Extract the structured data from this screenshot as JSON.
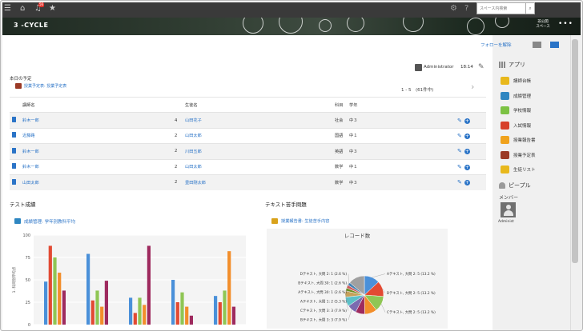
{
  "topbar": {
    "menu_icon": "hamburger-menu-icon",
    "home_icon": "home-icon",
    "bell_icon": "bell-icon",
    "notification_badge": "56",
    "star_icon": "star-icon",
    "gear_icon": "gear-icon",
    "help_icon": "help-icon",
    "search_placeholder": "スペース内検索",
    "search_icon": "search-icon"
  },
  "space": {
    "title": "3 -CYCLE",
    "private_badge": "非公開\nスペース",
    "more": "•••",
    "follow_label": "フォローを解除"
  },
  "post": {
    "author": "Administrator",
    "time": "18:14"
  },
  "schedule": {
    "heading": "本日の予定",
    "app_name": "授業予定表: 授業予定表",
    "pager": "1 - 5　(61件中)",
    "next": "›",
    "columns": [
      "講師名",
      "",
      "生徒名",
      "科目",
      "学年"
    ],
    "rows": [
      {
        "teacher": "鈴木一郎",
        "num": "4",
        "student": "山田花子",
        "subject": "社会",
        "grade": "中３"
      },
      {
        "teacher": "近藤路",
        "num": "2",
        "student": "山田太郎",
        "subject": "国語",
        "grade": "中１"
      },
      {
        "teacher": "鈴木一郎",
        "num": "2",
        "student": "川田五郎",
        "subject": "英語",
        "grade": "中３"
      },
      {
        "teacher": "鈴木一郎",
        "num": "2",
        "student": "山田太郎",
        "subject": "数学",
        "grade": "中１"
      },
      {
        "teacher": "山田太郎",
        "num": "2",
        "student": "豊田剛太郎",
        "subject": "数学",
        "grade": "中３"
      }
    ]
  },
  "widget_scores": {
    "title": "テスト成績",
    "app_name": "成績管理: 学年別教科平均"
  },
  "widget_weak": {
    "title": "テキスト苦手問題",
    "app_name": "授業報告書: 生徒苦手内容"
  },
  "sidebar": {
    "apps_title": "アプリ",
    "apps": [
      {
        "label": "講師台帳",
        "color": "#e8b81c",
        "icon": "ledger-icon"
      },
      {
        "label": "成績管理",
        "color": "#2e86c1",
        "icon": "grades-icon"
      },
      {
        "label": "学校情報",
        "color": "#7cc243",
        "icon": "school-icon"
      },
      {
        "label": "入試情報",
        "color": "#d7402b",
        "icon": "exam-icon"
      },
      {
        "label": "授業報告書",
        "color": "#f0a21c",
        "icon": "report-icon"
      },
      {
        "label": "授業予定表",
        "color": "#9b3a26",
        "icon": "calendar-icon"
      },
      {
        "label": "生徒リスト",
        "color": "#e8b81c",
        "icon": "student-list-icon"
      }
    ],
    "people_title": "ピープル",
    "members_label": "メンバー",
    "member_name": "Administ"
  },
  "chart_data": [
    {
      "type": "bar",
      "title": "",
      "ylabel": "1. 科目別平均点",
      "ylim": [
        0,
        100
      ],
      "yticks": [
        0,
        25,
        50,
        75,
        100
      ],
      "categories": [
        "",
        "",
        "",
        "",
        ""
      ],
      "series": [
        {
          "color": "#4a90d9",
          "values": [
            48,
            79,
            30,
            50,
            32
          ]
        },
        {
          "color": "#e24a33",
          "values": [
            88,
            27,
            13,
            25,
            25
          ]
        },
        {
          "color": "#8fc654",
          "values": [
            75,
            38,
            30,
            36,
            38
          ]
        },
        {
          "color": "#f28e2b",
          "values": [
            58,
            20,
            22,
            20,
            82
          ]
        },
        {
          "color": "#9e2a5e",
          "values": [
            38,
            49,
            88,
            10,
            20
          ]
        }
      ]
    },
    {
      "type": "pie",
      "title": "レコード数",
      "slices": [
        {
          "label": "Aテキスト, 大問 2: 5 (13.2 %)",
          "value": 13.2,
          "color": "#4a90d9"
        },
        {
          "label": "Bテキスト, 大問 2: 5 (13.2 %)",
          "value": 13.2,
          "color": "#e24a33"
        },
        {
          "label": "Cテキスト, 大問 2: 5 (13.2 %)",
          "value": 13.2,
          "color": "#8fc654"
        },
        {
          "label": "",
          "value": 10.5,
          "color": "#f28e2b"
        },
        {
          "label": "",
          "value": 7.9,
          "color": "#9e2a5e"
        },
        {
          "label": "Bテキスト, 大問 3: 3 (7.9 %)",
          "value": 7.9,
          "color": "#7b6bb0"
        },
        {
          "label": "Cテキスト, 大問 3: 3 (7.9 %)",
          "value": 7.9,
          "color": "#5bc0c8"
        },
        {
          "label": "Aテキスト, 大問 1: 2 (5.3 %)",
          "value": 5.3,
          "color": "#c7a15a"
        },
        {
          "label": "Aテキスト, 大問 30: 1 (2.6 %)",
          "value": 2.6,
          "color": "#6b8e23"
        },
        {
          "label": "Bテキスト, 大問 30: 1 (2.6 %)",
          "value": 2.6,
          "color": "#cd5c5c"
        },
        {
          "label": "Dテキスト, 大問 2: 1 (2.6 %)",
          "value": 2.6,
          "color": "#4682b4"
        },
        {
          "label": "",
          "value": 13.9,
          "color": "#a0a0a0"
        }
      ]
    }
  ]
}
